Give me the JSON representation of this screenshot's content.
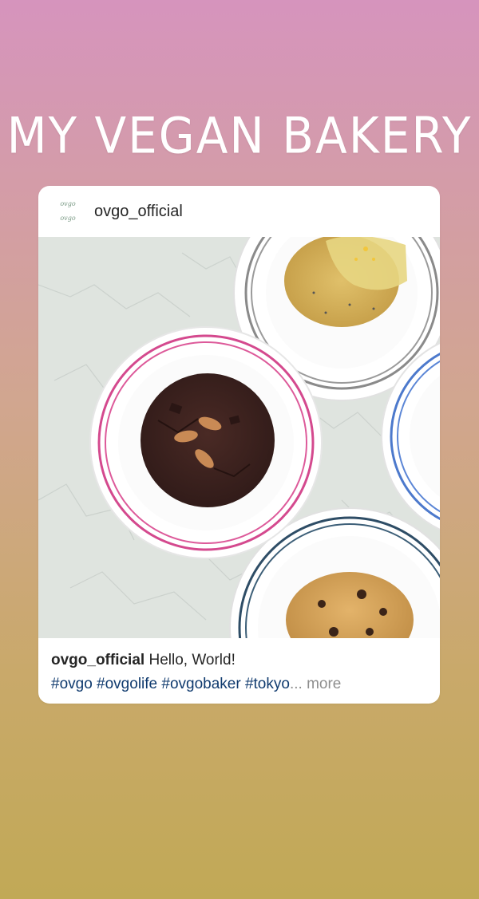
{
  "story": {
    "headline": "MY VEGAN BAKERY"
  },
  "post": {
    "avatar_text": [
      "ovgo",
      "ovgo"
    ],
    "username": "ovgo_official",
    "caption": {
      "username": "ovgo_official",
      "text": "Hello, World!",
      "hashtags": "#ovgo #ovgolife #ovgobaker #tokyo",
      "ellipsis": "...",
      "more_label": "more"
    }
  },
  "colors": {
    "gradient_top": "#d694bd",
    "gradient_bottom": "#c1a956",
    "hashtag": "#0f3a6e"
  }
}
